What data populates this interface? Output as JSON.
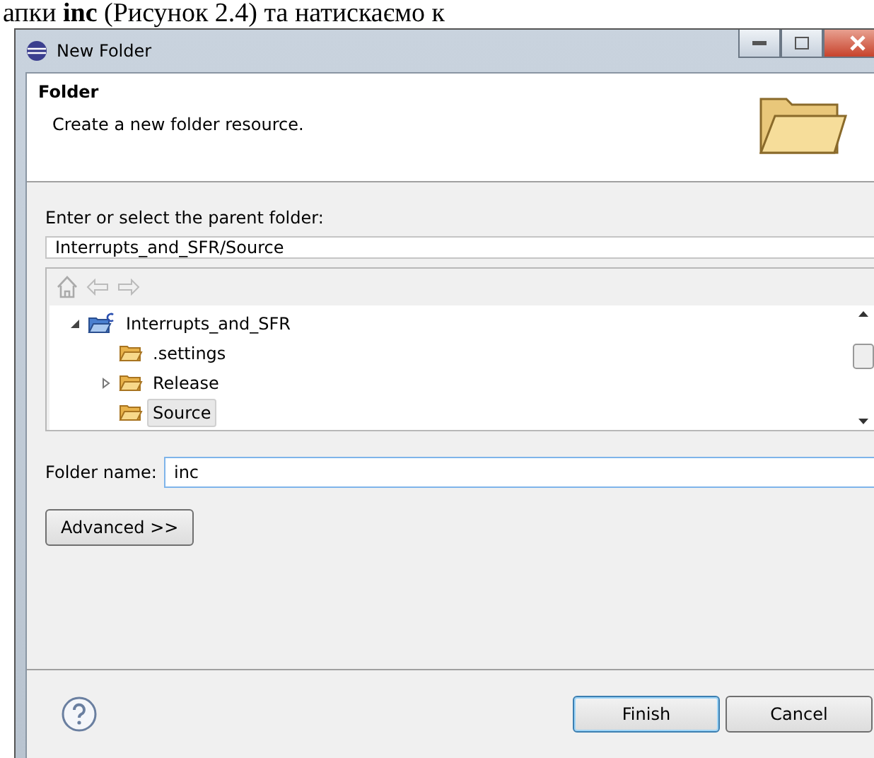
{
  "document_text": "апки **inc** (Рисунок 2.4) та натискаємо к",
  "window": {
    "title": "New Folder"
  },
  "header": {
    "title": "Folder",
    "description": "Create a new folder resource."
  },
  "parent_folder": {
    "label": "Enter or select the parent folder:",
    "value": "Interrupts_and_SFR/Source"
  },
  "tree": [
    {
      "label": "Interrupts_and_SFR",
      "kind": "project",
      "expanded": true,
      "selected": false,
      "children": [
        {
          "label": ".settings",
          "kind": "folder",
          "selected": false
        },
        {
          "label": "Release",
          "kind": "folder",
          "expanded": false,
          "selected": false
        },
        {
          "label": "Source",
          "kind": "folder",
          "selected": true
        }
      ]
    }
  ],
  "folder_name": {
    "label": "Folder name:",
    "value": "inc"
  },
  "advanced_button": "Advanced >>",
  "buttons": [
    {
      "label": "Finish",
      "default": true
    },
    {
      "label": "Cancel",
      "default": false
    }
  ]
}
